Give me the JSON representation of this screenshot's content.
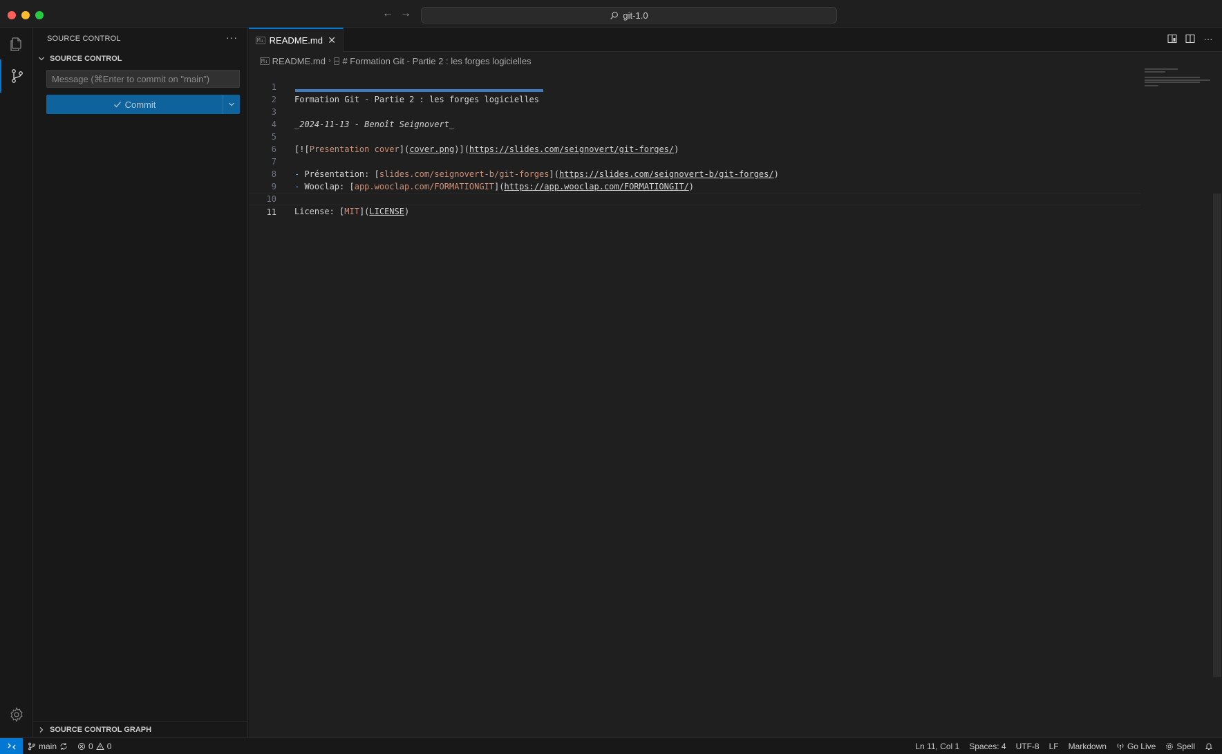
{
  "window": {
    "command_center": "git-1.0"
  },
  "sidebar": {
    "header": "SOURCE CONTROL",
    "section_title": "SOURCE CONTROL",
    "commit_placeholder": "Message (⌘Enter to commit on \"main\")",
    "commit_label": "Commit",
    "graph_section": "SOURCE CONTROL GRAPH"
  },
  "editor": {
    "tab_label": "README.md",
    "breadcrumb": {
      "file": "README.md",
      "symbol": "# Formation Git - Partie 2 : les forges logicielles"
    },
    "lines": [
      {
        "num": "1",
        "heading": "Formation Git - Partie 2 : les forges logicielles"
      },
      {
        "num": "2"
      },
      {
        "num": "3",
        "date": "_2024-11-13 - Benoît Seignovert_"
      },
      {
        "num": "4"
      },
      {
        "num": "5",
        "p1": "[![",
        "alt": "Presentation cover",
        "p2": "](",
        "img": "cover.png",
        "p3": ")](",
        "url": "https://slides.com/seignovert/git-forges/",
        "p4": ")"
      },
      {
        "num": "6"
      },
      {
        "num": "7",
        "bullet": "-",
        "label": " Présentation: ",
        "p1": "[",
        "text": "slides.com/seignovert-b/git-forges",
        "p2": "](",
        "url": "https://slides.com/seignovert-b/git-forges/",
        "p3": ")"
      },
      {
        "num": "8",
        "bullet": "-",
        "label": " Wooclap: ",
        "p1": "[",
        "text": "app.wooclap.com/FORMATIONGIT",
        "p2": "](",
        "url": "https://app.wooclap.com/FORMATIONGIT/",
        "p3": ")"
      },
      {
        "num": "9"
      },
      {
        "num": "10",
        "label": "License: ",
        "p1": "[",
        "text": "MIT",
        "p2": "](",
        "url": "LICENSE",
        "p3": ")"
      },
      {
        "num": "11"
      }
    ]
  },
  "statusbar": {
    "branch": "main",
    "errors": "0",
    "warnings": "0",
    "cursor": "Ln 11, Col 1",
    "spaces": "Spaces: 4",
    "encoding": "UTF-8",
    "eol": "LF",
    "language": "Markdown",
    "go_live": "Go Live",
    "spell": "Spell"
  },
  "colors": {
    "accent": "#0078d4",
    "commit_button": "#0e639c",
    "link_text": "#ce9178",
    "heading_underline": "#3e7bc2"
  }
}
